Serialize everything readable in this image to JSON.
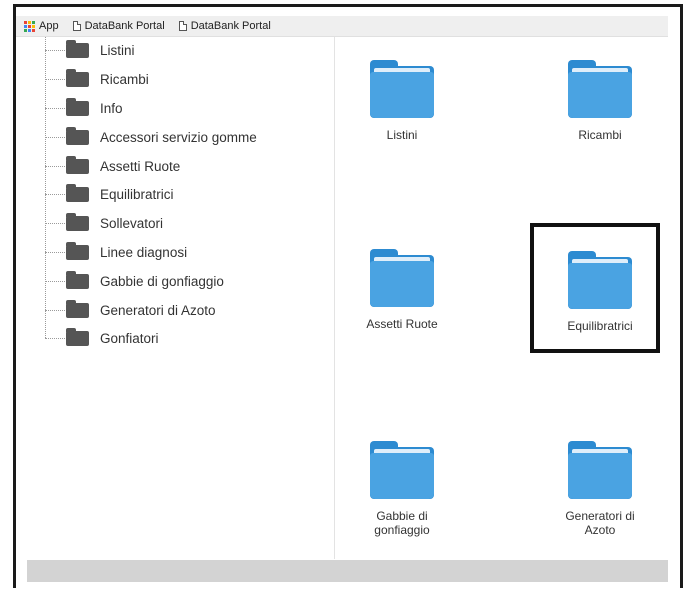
{
  "bookmarks": {
    "apps_label": "App",
    "items": [
      {
        "label": "DataBank Portal"
      },
      {
        "label": "DataBank Portal"
      }
    ]
  },
  "tree": {
    "items": [
      {
        "label": "Listini"
      },
      {
        "label": "Ricambi"
      },
      {
        "label": "Info"
      },
      {
        "label": "Accessori servizio gomme"
      },
      {
        "label": "Assetti Ruote"
      },
      {
        "label": "Equilibratrici"
      },
      {
        "label": "Sollevatori"
      },
      {
        "label": "Linee diagnosi"
      },
      {
        "label": "Gabbie di gonfiaggio"
      },
      {
        "label": "Generatori di Azoto"
      },
      {
        "label": "Gonfiatori"
      }
    ]
  },
  "grid": {
    "folders": [
      {
        "label": "Listini"
      },
      {
        "label": "Ricambi"
      },
      {
        "label": "Assetti Ruote"
      },
      {
        "label": "Equilibratrici",
        "highlighted": true
      },
      {
        "label": "Gabbie di\ngonfiaggio"
      },
      {
        "label": "Generatori di\nAzoto"
      }
    ]
  },
  "colors": {
    "folder_blue": "#4aa3e2",
    "tree_folder": "#555555",
    "highlight_border": "#111111"
  }
}
